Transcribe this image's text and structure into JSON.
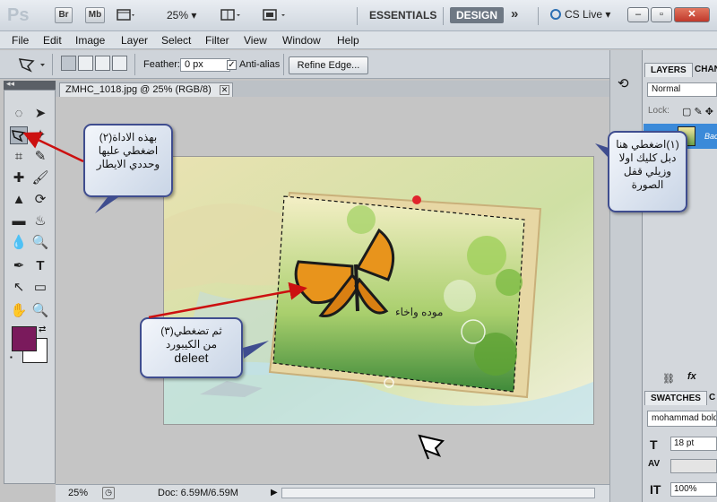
{
  "appbar": {
    "logo": "Ps",
    "buttons": {
      "bridge": "Br",
      "mini_bridge": "Mb"
    },
    "zoom": "25%",
    "workspaces": {
      "essentials": "ESSENTIALS",
      "design": "DESIGN",
      "more": "»"
    },
    "cslive": "CS Live",
    "window_controls": {
      "minimize": "–",
      "restore": "▫",
      "close": "✕"
    }
  },
  "menubar": [
    "File",
    "Edit",
    "Image",
    "Layer",
    "Select",
    "Filter",
    "View",
    "Window",
    "Help"
  ],
  "options": {
    "feather_label": "Feather:",
    "feather_value": "0 px",
    "antialias_label": "Anti-alias",
    "antialias_checked": true,
    "refine_edge_label": "Refine Edge..."
  },
  "document": {
    "tab_title": "ZMHC_1018.jpg @ 25% (RGB/8)",
    "close_glyph": "✕",
    "photo_caption": "موده واخاء"
  },
  "status": {
    "zoom": "25%",
    "doc_info": "Doc: 6.59M/6.59M"
  },
  "tools": {
    "rows": [
      [
        "◌",
        "➤"
      ],
      [
        "⛛",
        "✦"
      ],
      [
        "⌗",
        "✎"
      ],
      [
        "✚",
        "🖌"
      ],
      [
        "▲",
        "⟳"
      ],
      [
        "▬",
        "♨"
      ],
      [
        "💧",
        "🔍"
      ],
      [
        "✒",
        "T"
      ],
      [
        "↖",
        "▭"
      ],
      [
        "✋",
        "🔍"
      ]
    ],
    "foreground_color": "#7a1a5c",
    "background_color": "#ffffff"
  },
  "panels": {
    "layers_tab": "LAYERS",
    "channels_tab": "CHAN",
    "blend_mode": "Normal",
    "lock_label": "Lock:",
    "layer_name": "Bac",
    "swatches_tab": "SWATCHES",
    "char_tab": "C",
    "font_family": "mohammad bold",
    "font_size": "18 pt",
    "scale": "100%"
  },
  "callouts": {
    "step2": "بهذه الاداة(٢) اضغطي عليها وحددي الايطار",
    "step1": "(١)اضغطي هنا دبل كليك اولا وزيلي قفل الصورة",
    "step3_line1": "ثم تضغطي(٣)",
    "step3_line2": "من الكيبورد",
    "step3_line3": "deleet"
  }
}
